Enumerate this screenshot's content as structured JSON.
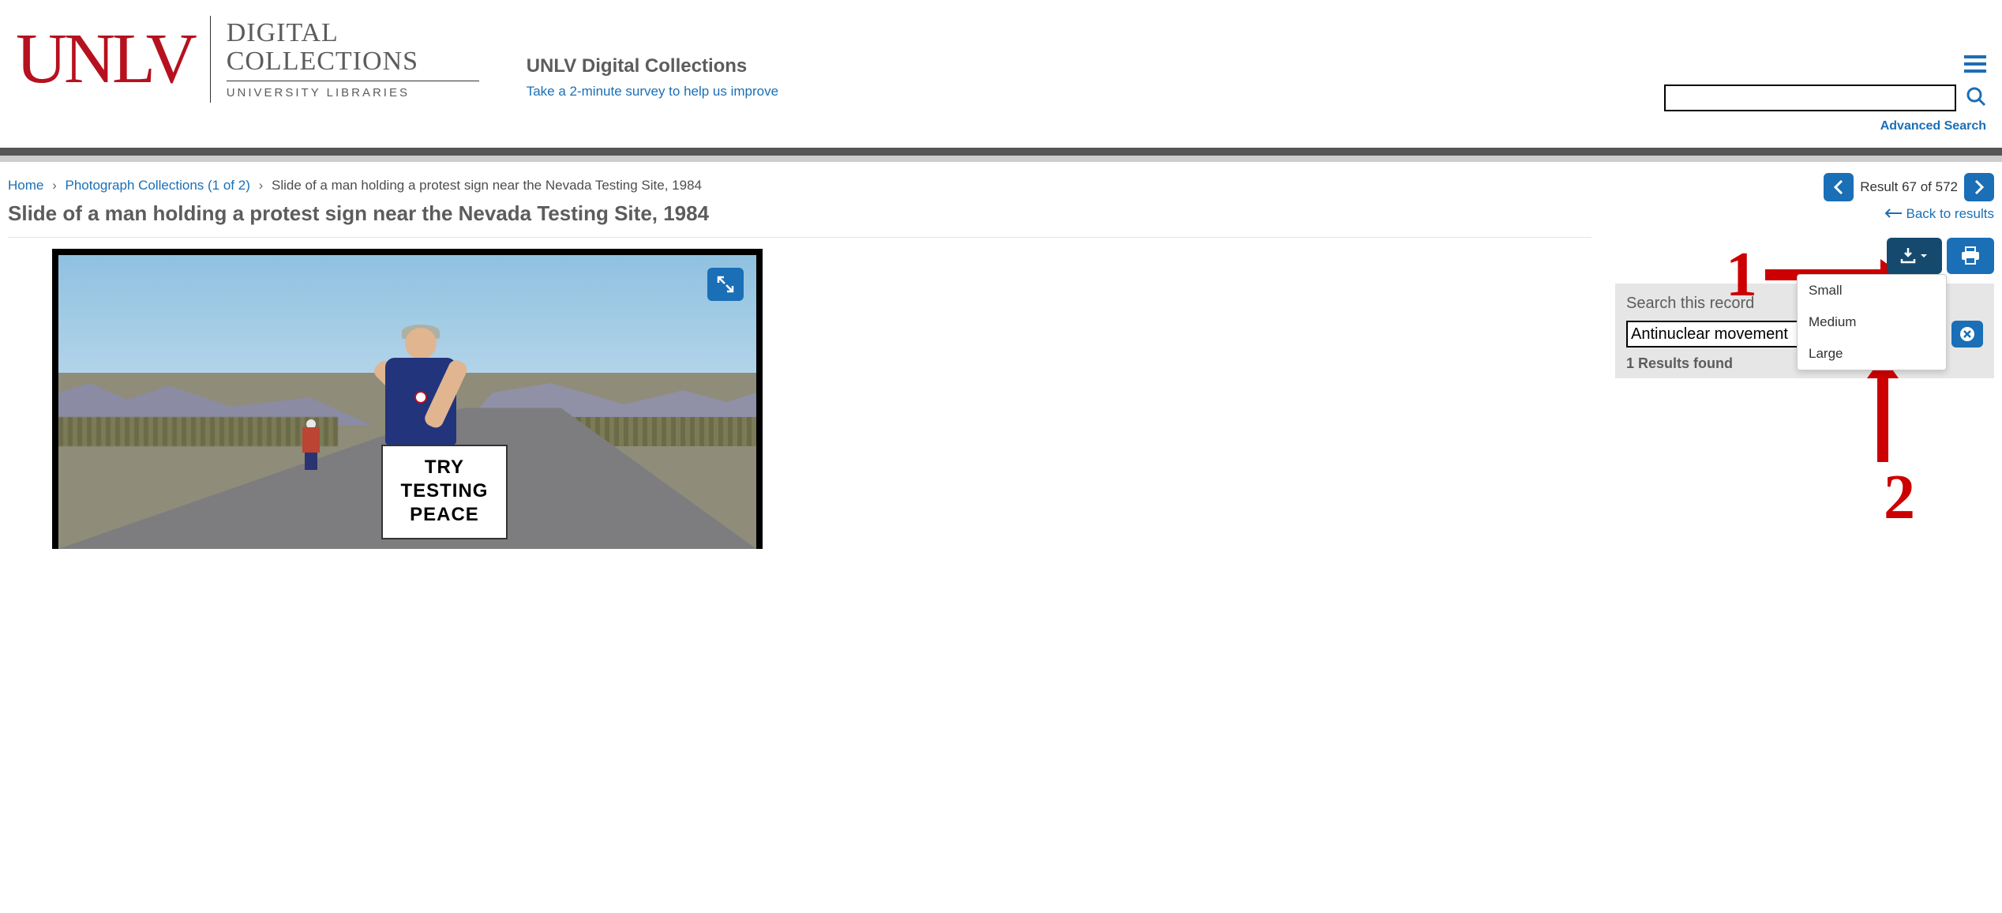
{
  "logo": {
    "brand": "UNLV",
    "line1": "DIGITAL",
    "line2": "COLLECTIONS",
    "sub": "UNIVERSITY LIBRARIES"
  },
  "header": {
    "site_title": "UNLV Digital Collections",
    "survey_link": "Take a 2-minute survey to help us improve",
    "advanced_search": "Advanced Search"
  },
  "breadcrumb": {
    "home": "Home",
    "collection": "Photograph Collections (1 of 2)",
    "current": "Slide of a man holding a protest sign near the Nevada Testing Site, 1984"
  },
  "page_title": "Slide of a man holding a protest sign near the Nevada Testing Site, 1984",
  "sign": {
    "line1": "TRY",
    "line2": "TESTING",
    "line3": "PEACE"
  },
  "results": {
    "label": "Result 67 of 572",
    "back": "Back to results"
  },
  "download_menu": [
    "Small",
    "Medium",
    "Large"
  ],
  "search_record": {
    "title": "Search this record",
    "value": "Antinuclear movement",
    "results_found": "1 Results found"
  },
  "annotations": {
    "one": "1",
    "two": "2"
  }
}
